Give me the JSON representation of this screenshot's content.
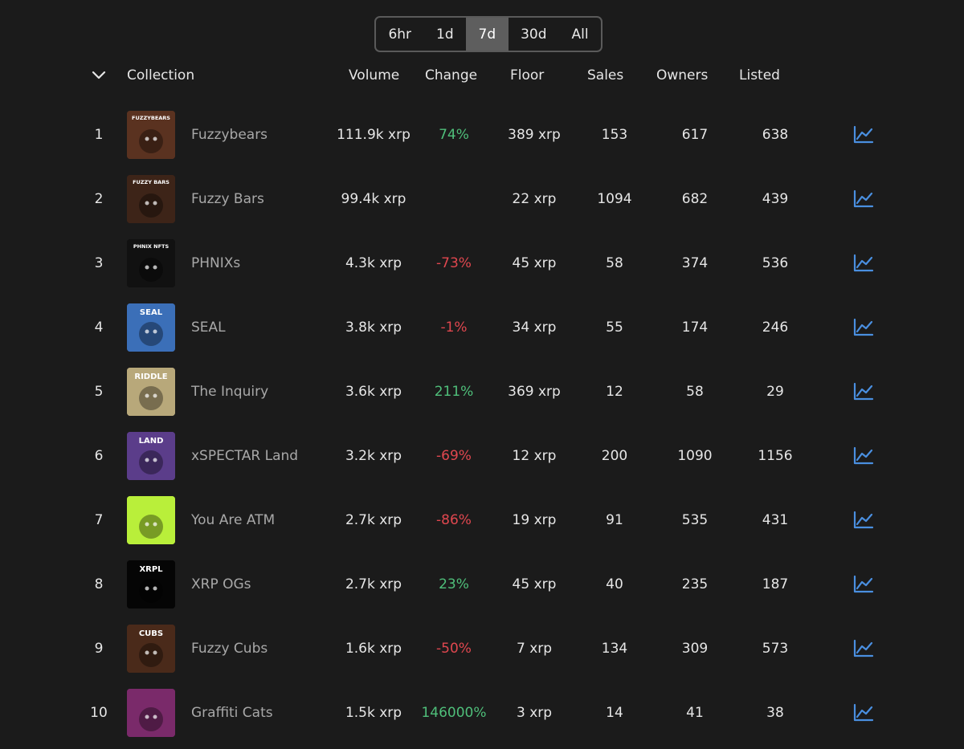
{
  "timeframes": [
    {
      "label": "6hr",
      "active": false
    },
    {
      "label": "1d",
      "active": false
    },
    {
      "label": "7d",
      "active": true
    },
    {
      "label": "30d",
      "active": false
    },
    {
      "label": "All",
      "active": false
    }
  ],
  "headers": {
    "collection": "Collection",
    "volume": "Volume",
    "change": "Change",
    "floor": "Floor",
    "sales": "Sales",
    "owners": "Owners",
    "listed": "Listed"
  },
  "colors": {
    "positive": "#4fbf7a",
    "negative": "#e0474f",
    "accent": "#4a8fe0",
    "background": "#1b1b1b"
  },
  "rows": [
    {
      "rank": "1",
      "name": "Fuzzybears",
      "volume": "111.9k xrp",
      "change": "74%",
      "change_dir": "pos",
      "floor": "389 xrp",
      "sales": "153",
      "owners": "617",
      "listed": "638",
      "thumb_text": "FUZZYBEARS",
      "thumb_bg": "#5a3220"
    },
    {
      "rank": "2",
      "name": "Fuzzy Bars",
      "volume": "99.4k xrp",
      "change": "",
      "change_dir": "none",
      "floor": "22 xrp",
      "sales": "1094",
      "owners": "682",
      "listed": "439",
      "thumb_text": "FUZZY BARS",
      "thumb_bg": "#3d2418"
    },
    {
      "rank": "3",
      "name": "PHNIXs",
      "volume": "4.3k xrp",
      "change": "-73%",
      "change_dir": "neg",
      "floor": "45 xrp",
      "sales": "58",
      "owners": "374",
      "listed": "536",
      "thumb_text": "PHNIX NFTS",
      "thumb_bg": "#111111"
    },
    {
      "rank": "4",
      "name": "SEAL",
      "volume": "3.8k xrp",
      "change": "-1%",
      "change_dir": "neg",
      "floor": "34 xrp",
      "sales": "55",
      "owners": "174",
      "listed": "246",
      "thumb_text": "SEAL",
      "thumb_bg": "#3b6fb8"
    },
    {
      "rank": "5",
      "name": "The Inquiry",
      "volume": "3.6k xrp",
      "change": "211%",
      "change_dir": "pos",
      "floor": "369 xrp",
      "sales": "12",
      "owners": "58",
      "listed": "29",
      "thumb_text": "RIDDLE",
      "thumb_bg": "#b8a87a"
    },
    {
      "rank": "6",
      "name": "xSPECTAR Land",
      "volume": "3.2k xrp",
      "change": "-69%",
      "change_dir": "neg",
      "floor": "12 xrp",
      "sales": "200",
      "owners": "1090",
      "listed": "1156",
      "thumb_text": "LAND",
      "thumb_bg": "#5b3d8a"
    },
    {
      "rank": "7",
      "name": "You Are ATM",
      "volume": "2.7k xrp",
      "change": "-86%",
      "change_dir": "neg",
      "floor": "19 xrp",
      "sales": "91",
      "owners": "535",
      "listed": "431",
      "thumb_text": "",
      "thumb_bg": "#b9ef3a"
    },
    {
      "rank": "8",
      "name": "XRP OGs",
      "volume": "2.7k xrp",
      "change": "23%",
      "change_dir": "pos",
      "floor": "45 xrp",
      "sales": "40",
      "owners": "235",
      "listed": "187",
      "thumb_text": "XRPL",
      "thumb_bg": "#050505"
    },
    {
      "rank": "9",
      "name": "Fuzzy Cubs",
      "volume": "1.6k xrp",
      "change": "-50%",
      "change_dir": "neg",
      "floor": "7 xrp",
      "sales": "134",
      "owners": "309",
      "listed": "573",
      "thumb_text": "CUBS",
      "thumb_bg": "#4a2a1a"
    },
    {
      "rank": "10",
      "name": "Graffiti Cats",
      "volume": "1.5k xrp",
      "change": "146000%",
      "change_dir": "pos",
      "floor": "3 xrp",
      "sales": "14",
      "owners": "41",
      "listed": "38",
      "thumb_text": "",
      "thumb_bg": "#7a2a6a"
    }
  ]
}
